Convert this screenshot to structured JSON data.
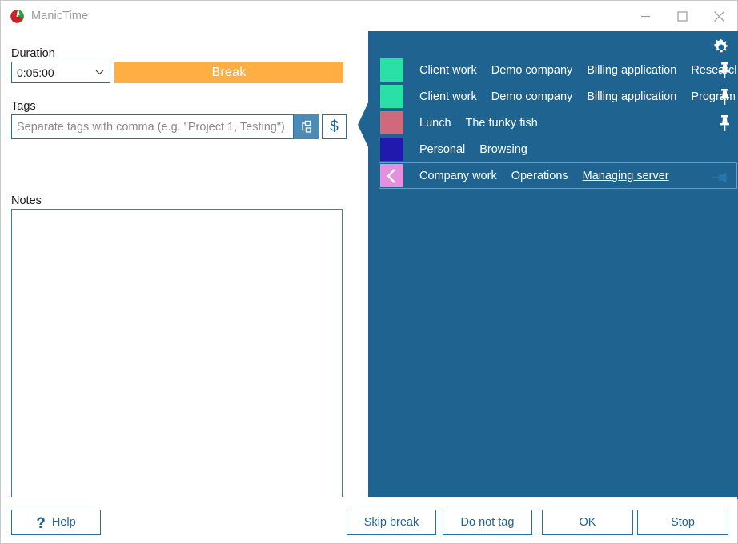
{
  "window": {
    "title": "ManicTime",
    "logo_icon": "manictime-logo-icon",
    "minimize_icon": "minimize-icon",
    "maximize_icon": "maximize-icon",
    "close_icon": "close-icon"
  },
  "form": {
    "duration_label": "Duration",
    "duration_value": "0:05:00",
    "duration_chevron_icon": "chevron-down-icon",
    "break_label": "Break",
    "tags_label": "Tags",
    "tags_placeholder": "Separate tags with comma (e.g. \"Project 1, Testing\")",
    "tags_value": "",
    "tag_tree_icon": "tag-hierarchy-icon",
    "billable_icon": "dollar-icon",
    "notes_label": "Notes",
    "notes_value": ""
  },
  "tag_panel": {
    "settings_icon": "gear-icon",
    "callout_arrow_icon": "callout-arrow-left-icon",
    "colors": {
      "panel_background": "#1f6391",
      "selected_border": "#63a0c4",
      "break_orange": "#ffae44",
      "accent_blue": "#1f6391"
    },
    "rows": [
      {
        "swatch_color": "#2ae0a6",
        "parts": [
          "Client work",
          "Demo company",
          "Billing application",
          "Research"
        ],
        "underline_last": false,
        "pin_icon": "pin-icon",
        "pin_state": "unpinned",
        "selected": false
      },
      {
        "swatch_color": "#2ae0a6",
        "parts": [
          "Client work",
          "Demo company",
          "Billing application",
          "Program"
        ],
        "underline_last": false,
        "pin_icon": "pin-icon",
        "pin_state": "unpinned",
        "selected": false
      },
      {
        "swatch_color": "#ce6a7c",
        "parts": [
          "Lunch",
          "The funky fish"
        ],
        "underline_last": false,
        "pin_icon": "pin-icon",
        "pin_state": "unpinned",
        "selected": false
      },
      {
        "swatch_color": "#2119ad",
        "parts": [
          "Personal",
          "Browsing"
        ],
        "underline_last": false,
        "pin_icon": "",
        "pin_state": "none",
        "selected": false
      },
      {
        "swatch_color": "#e48fe0",
        "swatch_icon": "chevron-left-icon",
        "parts": [
          "Company work",
          "Operations",
          "Managing server"
        ],
        "underline_last": true,
        "pin_icon": "pin-flag-icon",
        "pin_state": "pinned",
        "selected": true
      }
    ]
  },
  "footer": {
    "help_icon": "question-mark-icon",
    "help_label": "Help",
    "skip_break_label": "Skip break",
    "do_not_tag_label": "Do not tag",
    "ok_label": "OK",
    "stop_label": "Stop"
  }
}
